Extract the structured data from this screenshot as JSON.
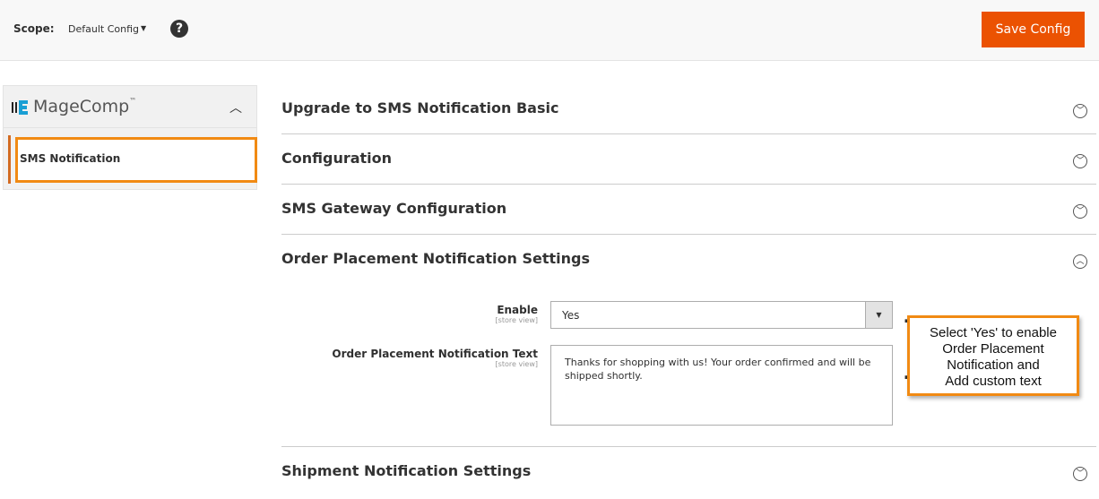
{
  "header": {
    "scope_label": "Scope:",
    "scope_value": "Default Config",
    "help": "?",
    "save_label": "Save Config"
  },
  "sidebar": {
    "brand": "MageComp",
    "tm": "™",
    "item": "SMS Notification"
  },
  "sections": [
    {
      "title": "Upgrade to SMS Notification Basic",
      "expanded": false
    },
    {
      "title": "Configuration",
      "expanded": false
    },
    {
      "title": "SMS Gateway Configuration",
      "expanded": false
    },
    {
      "title": "Order Placement Notification Settings",
      "expanded": true
    },
    {
      "title": "Shipment Notification Settings",
      "expanded": false
    }
  ],
  "form": {
    "enable_label": "Enable",
    "enable_scope": "[store view]",
    "enable_value": "Yes",
    "text_label": "Order Placement Notification Text",
    "text_scope": "[store view]",
    "text_value": "Thanks for shopping with us! Your order confirmed and will be shipped shortly."
  },
  "callout": {
    "lines": [
      "Select 'Yes' to enable",
      "Order Placement",
      "Notification and",
      "Add custom text"
    ]
  },
  "colors": {
    "accent": "#eb5202",
    "highlight": "#f18a13"
  }
}
